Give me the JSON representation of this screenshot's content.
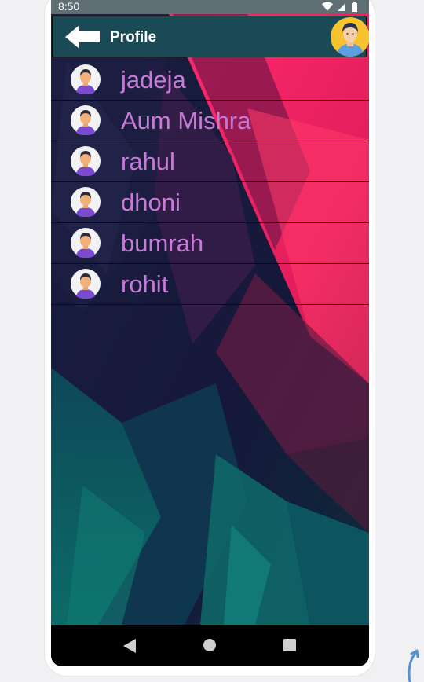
{
  "status_bar": {
    "time": "8:50",
    "icons": [
      "wifi-icon",
      "signal-icon",
      "battery-icon"
    ]
  },
  "app_bar": {
    "back_icon": "arrow-left-icon",
    "title": "Profile",
    "avatar_icon": "user-avatar-icon"
  },
  "users": [
    {
      "name": "jadeja"
    },
    {
      "name": "Aum Mishra"
    },
    {
      "name": "rahul"
    },
    {
      "name": "dhoni"
    },
    {
      "name": "bumrah"
    },
    {
      "name": "rohit"
    }
  ],
  "nav_bar": {
    "buttons": [
      "back-triangle-icon",
      "home-circle-icon",
      "recents-square-icon"
    ]
  },
  "colors": {
    "app_bar_bg": "#1a4a55",
    "name_text": "#c77ad6",
    "status_bar_bg": "#5f6f73",
    "background_magenta": "#ff2a6d",
    "background_navy": "#13132a",
    "background_teal": "#0f6b6a"
  }
}
